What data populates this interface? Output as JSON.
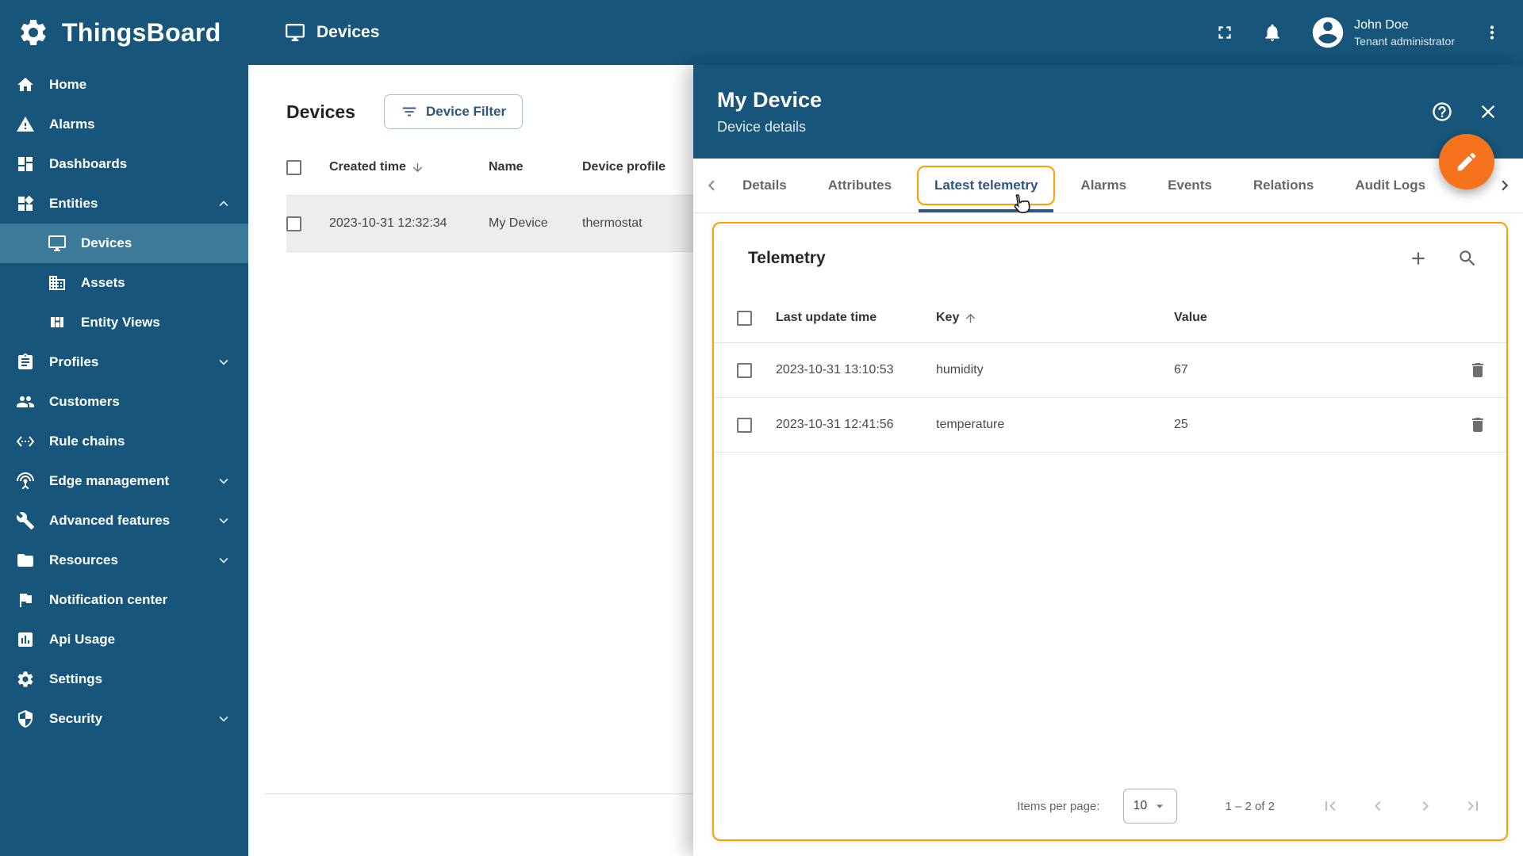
{
  "app": {
    "name": "ThingsBoard"
  },
  "topbar": {
    "title": "Devices",
    "user": {
      "name": "John Doe",
      "role": "Tenant administrator"
    }
  },
  "sidebar": {
    "items": [
      {
        "label": "Home",
        "icon": "home-icon"
      },
      {
        "label": "Alarms",
        "icon": "alarms-icon"
      },
      {
        "label": "Dashboards",
        "icon": "dashboards-icon"
      },
      {
        "label": "Entities",
        "icon": "entities-icon"
      },
      {
        "label": "Devices",
        "icon": "devices-icon"
      },
      {
        "label": "Assets",
        "icon": "assets-icon"
      },
      {
        "label": "Entity Views",
        "icon": "entity-views-icon"
      },
      {
        "label": "Profiles",
        "icon": "profiles-icon"
      },
      {
        "label": "Customers",
        "icon": "customers-icon"
      },
      {
        "label": "Rule chains",
        "icon": "rule-chains-icon"
      },
      {
        "label": "Edge management",
        "icon": "edge-management-icon"
      },
      {
        "label": "Advanced features",
        "icon": "advanced-features-icon"
      },
      {
        "label": "Resources",
        "icon": "resources-icon"
      },
      {
        "label": "Notification center",
        "icon": "notification-center-icon"
      },
      {
        "label": "Api Usage",
        "icon": "api-usage-icon"
      },
      {
        "label": "Settings",
        "icon": "settings-icon"
      },
      {
        "label": "Security",
        "icon": "security-icon"
      }
    ]
  },
  "devices_table": {
    "title": "Devices",
    "filter_button": "Device Filter",
    "columns": {
      "created": "Created time",
      "name": "Name",
      "profile": "Device profile"
    },
    "rows": [
      {
        "created": "2023-10-31 12:32:34",
        "name": "My Device",
        "profile": "thermostat"
      }
    ]
  },
  "details_panel": {
    "title": "My Device",
    "subtitle": "Device details",
    "tabs": [
      "Details",
      "Attributes",
      "Latest telemetry",
      "Alarms",
      "Events",
      "Relations",
      "Audit Logs"
    ],
    "active_tab": "Latest telemetry",
    "telemetry": {
      "title": "Telemetry",
      "columns": {
        "time": "Last update time",
        "key": "Key",
        "value": "Value"
      },
      "rows": [
        {
          "time": "2023-10-31 13:10:53",
          "key": "humidity",
          "value": "67"
        },
        {
          "time": "2023-10-31 12:41:56",
          "key": "temperature",
          "value": "25"
        }
      ],
      "pagination": {
        "items_per_page_label": "Items per page:",
        "items_per_page": "10",
        "range": "1 – 2 of 2"
      }
    }
  },
  "colors": {
    "primary": "#17567a",
    "sidebar_active": "#3d7a99",
    "accent": "#305680",
    "highlight": "#ffa000",
    "fab": "#f4731c"
  }
}
